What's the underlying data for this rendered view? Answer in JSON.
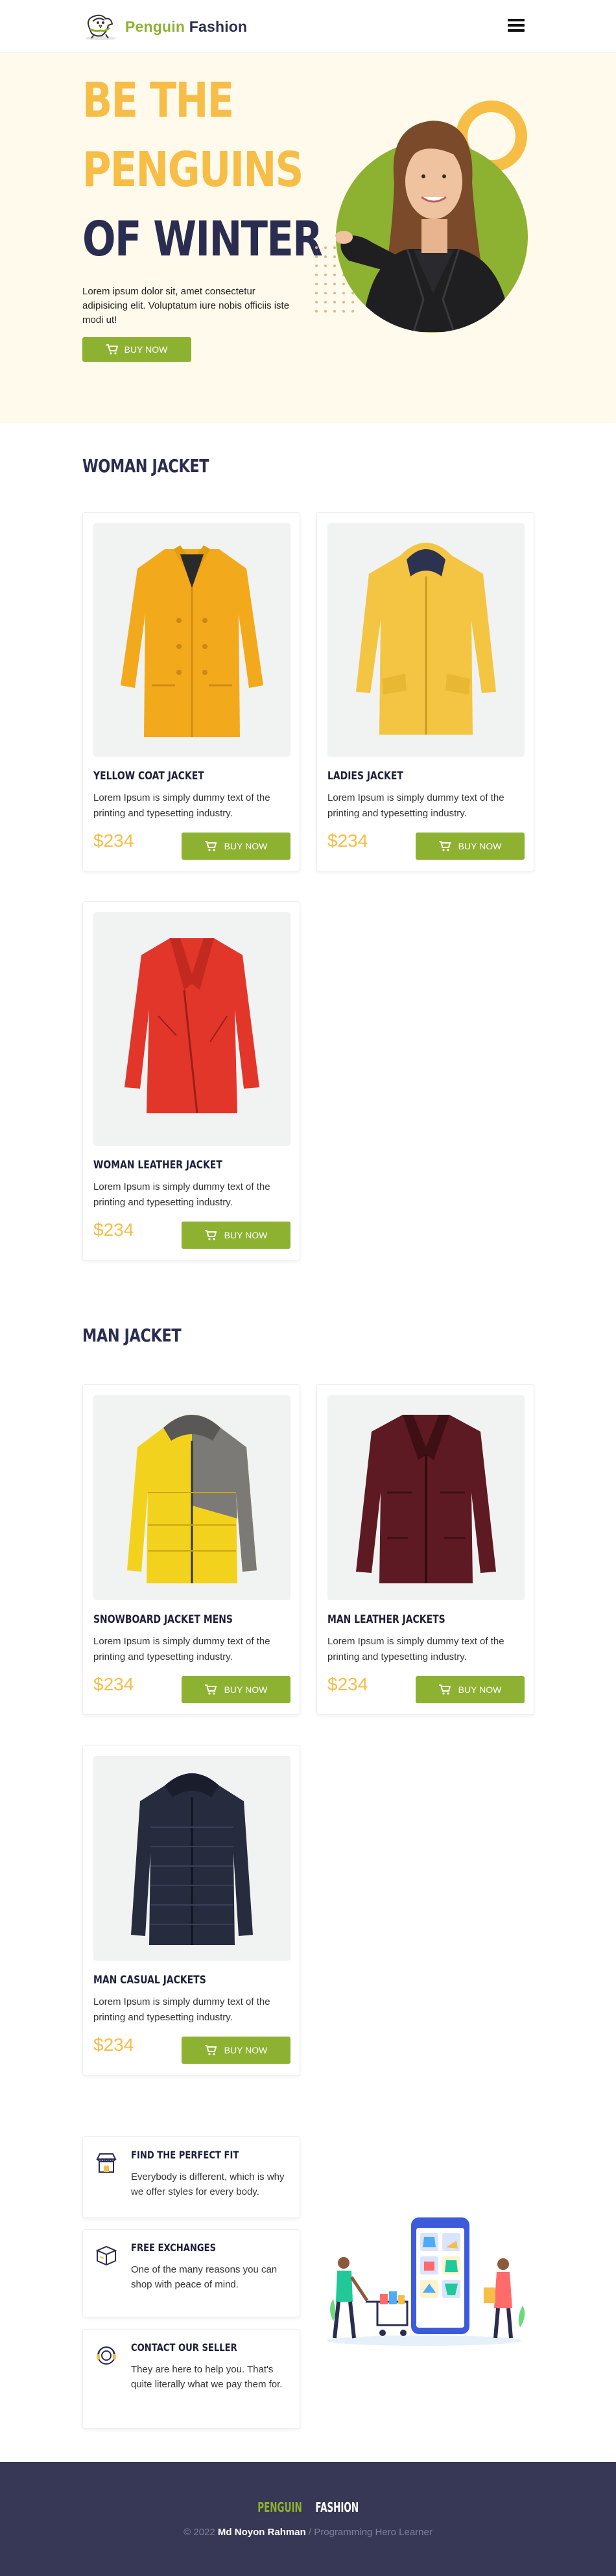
{
  "navbar": {
    "brand_part1": "Penguin",
    "brand_part2": "Fashion",
    "logo_icon": "penguin-logo-icon",
    "menu_icon": "hamburger-menu-icon"
  },
  "hero": {
    "title_line1": "BE THE",
    "title_line2": "PENGUINS",
    "title_line3": "OF WINTER",
    "description": "Lorem ipsum dolor sit, amet consectetur adipisicing elit. Voluptatum iure nobis officiis iste modi ut!",
    "button_label": "BUY NOW",
    "button_icon": "cart-icon"
  },
  "woman_section": {
    "title": "WOMAN JACKET",
    "products": [
      {
        "name": "YELLOW COAT JACKET",
        "description": "Lorem Ipsum is simply dummy text of the printing and typesetting industry.",
        "price": "$234",
        "button": "BUY NOW",
        "image": "yellow-coat-image"
      },
      {
        "name": "LADIES JACKET",
        "description": "Lorem Ipsum is simply dummy text of the printing and typesetting industry.",
        "price": "$234",
        "button": "BUY NOW",
        "image": "yellow-hooded-jacket-image"
      },
      {
        "name": "WOMAN LEATHER JACKET",
        "description": "Lorem Ipsum is simply dummy text of the printing and typesetting industry.",
        "price": "$234",
        "button": "BUY NOW",
        "image": "red-leather-jacket-image"
      }
    ]
  },
  "man_section": {
    "title": "MAN JACKET",
    "products": [
      {
        "name": "SNOWBOARD JACKET MENS",
        "description": "Lorem Ipsum is simply dummy text of the printing and typesetting industry.",
        "price": "$234",
        "button": "BUY NOW",
        "image": "snowboard-jacket-image"
      },
      {
        "name": "MAN LEATHER JACKETS",
        "description": "Lorem Ipsum is simply dummy text of the printing and typesetting industry.",
        "price": "$234",
        "button": "BUY NOW",
        "image": "maroon-leather-jacket-image"
      },
      {
        "name": "MAN CASUAL JACKETS",
        "description": "Lorem Ipsum is simply dummy text of the printing and typesetting industry.",
        "price": "$234",
        "button": "BUY NOW",
        "image": "navy-puffer-jacket-image"
      }
    ]
  },
  "features": [
    {
      "title": "FIND THE PERFECT FIT",
      "description": "Everybody is different, which is why we offer styles for every body.",
      "icon": "store-icon"
    },
    {
      "title": "FREE EXCHANGES",
      "description": "One of the many reasons you can shop with peace of mind.",
      "icon": "exchange-box-icon"
    },
    {
      "title": "CONTACT OUR SELLER",
      "description": "They are here to help you. That's quite literally what we pay them for.",
      "icon": "support-icon"
    }
  ],
  "footer": {
    "brand_part1": "PENGUIN",
    "brand_part2": "FASHION",
    "copyright_prefix": "© 2022",
    "author": "Md Noyon Rahman",
    "copyright_suffix": "/ Programming Hero Learner"
  },
  "colors": {
    "accent_green": "#8db131",
    "accent_yellow": "#f6be46",
    "navy": "#2b2d50",
    "hero_bg": "#fffaeb",
    "footer_bg": "#373855"
  }
}
